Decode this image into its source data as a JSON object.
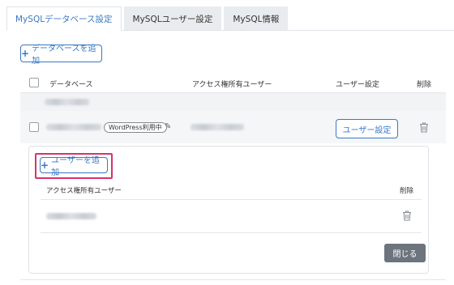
{
  "tabs": [
    {
      "label": "MySQLデータベース設定",
      "active": true
    },
    {
      "label": "MySQLユーザー設定",
      "active": false
    },
    {
      "label": "MySQL情報",
      "active": false
    }
  ],
  "toolbar": {
    "add_database_label": "データベースを追加"
  },
  "table": {
    "headers": {
      "database": "データベース",
      "access_user": "アクセス権所有ユーザー",
      "user_settings": "ユーザー設定",
      "delete": "削除"
    },
    "rows": [
      {
        "badge": "WordPress利用中",
        "action_label": "ユーザー設定"
      }
    ]
  },
  "panel": {
    "add_user_label": "ユーザーを追加",
    "headers": {
      "access_user": "アクセス権所有ユーザー",
      "delete": "削除"
    },
    "close_label": "閉じる"
  },
  "colors": {
    "accent": "#3a78c3",
    "highlight": "#d6336c",
    "close_button": "#6c757d"
  },
  "icons": [
    "plus-icon",
    "pencil-icon",
    "trash-icon",
    "checkbox"
  ]
}
